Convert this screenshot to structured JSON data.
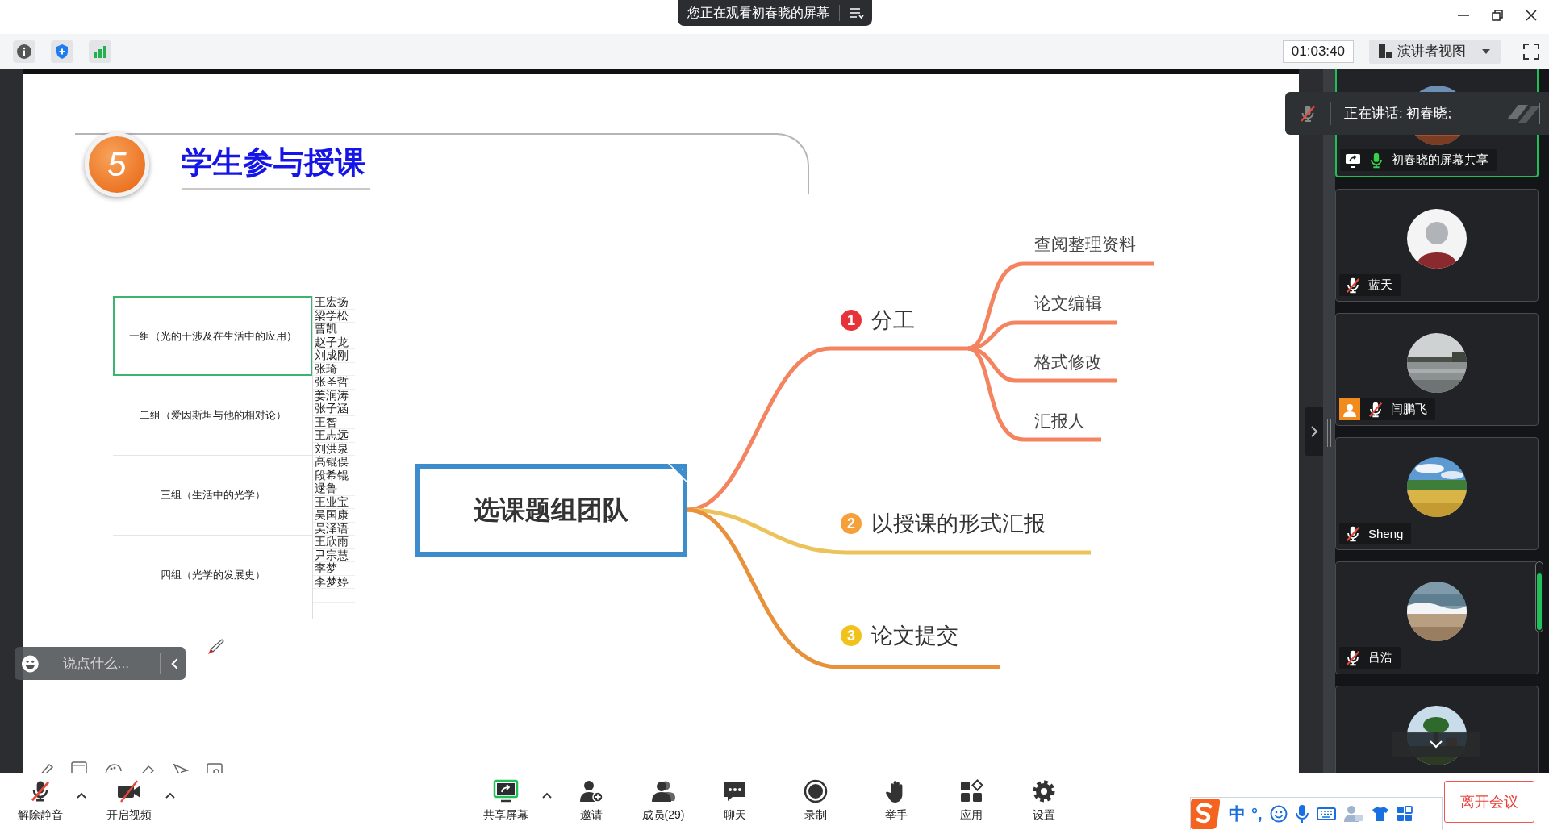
{
  "top_bar": {
    "sharing_notice": "您正在观看初春晓的屏幕"
  },
  "toolbar": {
    "timer": "01:03:40",
    "view_mode": "演讲者视图"
  },
  "slide": {
    "section_number": "5",
    "title": "学生参与授课",
    "table": {
      "groups": [
        {
          "name": "一组（光的干涉及在生活中的应用）",
          "selected": true
        },
        {
          "name": "二组（爱因斯坦与他的相对论）",
          "selected": false
        },
        {
          "name": "三组（生活中的光学）",
          "selected": false
        },
        {
          "name": "四组（光学的发展史）",
          "selected": false
        }
      ],
      "members": [
        "王宏扬",
        "梁学松",
        "曹凯",
        "赵子龙",
        "刘成刚",
        "张琦",
        "张圣哲",
        "姜润涛",
        "张子涵",
        "王智",
        "王志远",
        "刘洪泉",
        "高锟俣",
        "段希锟",
        "逯鲁",
        "王业宝",
        "吴国康",
        "吴泽语",
        "王欣雨",
        "尹宗慧",
        "李梦",
        "李梦婷"
      ]
    },
    "mind_map": {
      "root": "选课题组团队",
      "branches": [
        {
          "number": "1",
          "label": "分工",
          "color": "#f4845f",
          "children": [
            {
              "label": "查阅整理资料"
            },
            {
              "label": "论文编辑"
            },
            {
              "label": "格式修改"
            },
            {
              "label": "汇报人"
            }
          ]
        },
        {
          "number": "2",
          "label": "以授课的形式汇报",
          "color": "#ecc35a"
        },
        {
          "number": "3",
          "label": "论文提交",
          "color": "#e8913a"
        }
      ]
    }
  },
  "chat_input": {
    "placeholder": "说点什么..."
  },
  "speaking_notice": "正在讲话: 初春晓;",
  "participants": [
    {
      "name": "初春晓的屏幕共享",
      "kind": "screen_share",
      "muted": false,
      "speaking": true,
      "host": false
    },
    {
      "name": "蓝天",
      "kind": "member",
      "muted": true,
      "speaking": false,
      "host": false
    },
    {
      "name": "闫鹏飞",
      "kind": "member",
      "muted": true,
      "speaking": false,
      "host": true
    },
    {
      "name": "Sheng",
      "kind": "member",
      "muted": true,
      "speaking": false,
      "host": false
    },
    {
      "name": "吕浩",
      "kind": "member",
      "muted": true,
      "speaking": false,
      "host": false
    },
    {
      "speaking": false
    }
  ],
  "bottom_bar": {
    "buttons": [
      {
        "label": "解除静音",
        "menu": true
      },
      {
        "label": "开启视频",
        "menu": true
      },
      {
        "label": "共享屏幕",
        "menu": true
      },
      {
        "label": "邀请",
        "menu": false
      },
      {
        "label": "成员(29)",
        "menu": false
      },
      {
        "label": "聊天",
        "menu": false
      },
      {
        "label": "录制",
        "menu": false
      },
      {
        "label": "举手",
        "menu": false
      },
      {
        "label": "应用",
        "menu": false
      },
      {
        "label": "设置",
        "menu": false
      }
    ],
    "leave_button": "离开会议"
  },
  "ime_bar": {
    "mode": "中",
    "punctuation": "°,"
  }
}
